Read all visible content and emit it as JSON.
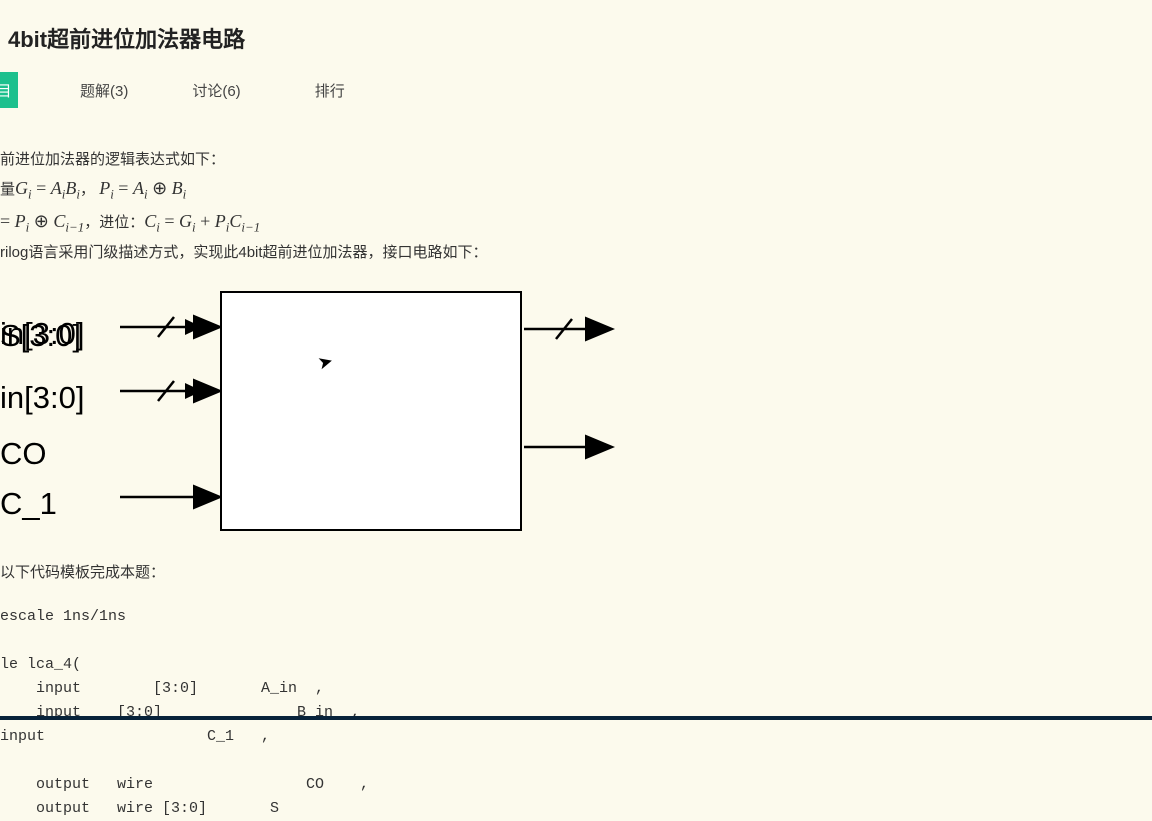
{
  "title": "4bit超前进位加法器电路",
  "tabs": {
    "active": "目",
    "t1": "题解(3)",
    "t2": "讨论(6)",
    "t3": "排行"
  },
  "desc": {
    "l1": "前进位加法器的逻辑表达式如下：",
    "l2_pre": "量",
    "l2_g": "G",
    "l2_eq1": " = ",
    "l2_AiBi": "A",
    "l2_Bi": "B",
    "l2_comma": "，",
    "l2_P": "P",
    "l2_eq2": " = ",
    "l2_Ai2": "A",
    "l2_op_oplus": " ⊕ ",
    "l2_Bi2": "B",
    "l3_pre": " = ",
    "l3_P": "P",
    "l3_oplus": " ⊕ ",
    "l3_C1": "C",
    "l3_mid": "，进位：",
    "l3_Ci": "C",
    "l3_eq": " = ",
    "l3_Gi": "G",
    "l3_plus": " + ",
    "l3_Pi": "P",
    "l3_Cim1": "C",
    "l4": "rilog语言采用门级描述方式，实现此4bit超前进位加法器，接口电路如下："
  },
  "diagram": {
    "ain": "in[3:0]",
    "bin": "in[3:0]",
    "c1": "C_1",
    "s": "S[3:0]",
    "co": "CO"
  },
  "template_note": "以下代码模板完成本题：",
  "code": "escale 1ns/1ns\n\nle lca_4(\n    input        [3:0]       A_in  ,\n    input    [3:0]               B_in  ,\ninput                  C_1   ,\n\n    output   wire                 CO    ,\n    output   wire [3:0]       S"
}
